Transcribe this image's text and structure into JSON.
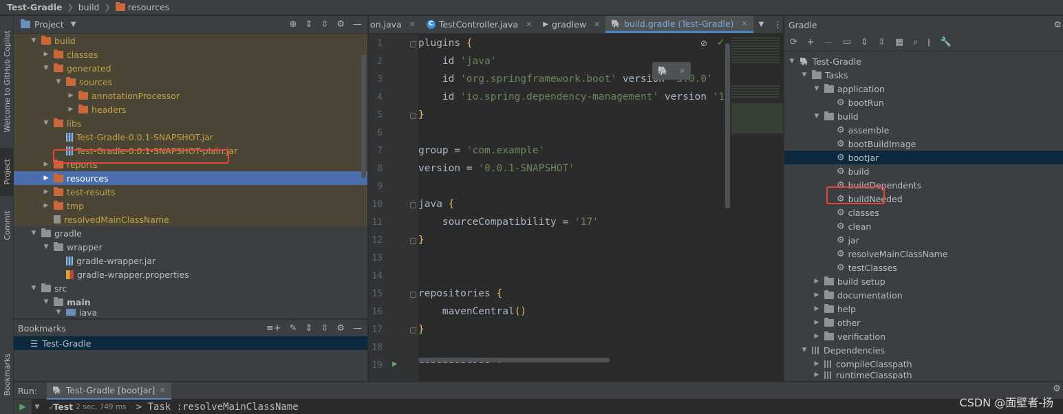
{
  "breadcrumb": {
    "project": "Test-Gradle",
    "item1": "build",
    "item2": "resources"
  },
  "left_strip": {
    "copilot": "Welcome to GitHub Copilot",
    "project": "Project",
    "commit": "Commit",
    "bookmarks": "Bookmarks"
  },
  "project_panel": {
    "title": "Project",
    "tree": {
      "build": "build",
      "classes": "classes",
      "generated": "generated",
      "sources": "sources",
      "annotationProcessor": "annotationProcessor",
      "headers": "headers",
      "libs": "libs",
      "jar1": "Test-Gradle-0.0.1-SNAPSHOT.jar",
      "jar2": "Test-Gradle-0.0.1-SNAPSHOT-plain.jar",
      "reports": "reports",
      "resources": "resources",
      "test_results": "test-results",
      "tmp": "tmp",
      "resolved": "resolvedMainClassName",
      "gradle": "gradle",
      "wrapper": "wrapper",
      "wrapper_jar": "gradle-wrapper.jar",
      "wrapper_props": "gradle-wrapper.properties",
      "src": "src",
      "main": "main",
      "java": "java"
    }
  },
  "bookmarks": {
    "title": "Bookmarks",
    "item": "Test-Gradle"
  },
  "editor": {
    "tabs": [
      "on.java",
      "TestController.java",
      "gradlew",
      "build.gradle (Test-Gradle)"
    ],
    "line_numbers": [
      "1",
      "2",
      "3",
      "4",
      "5",
      "6",
      "7",
      "8",
      "9",
      "10",
      "11",
      "12",
      "13",
      "14",
      "15",
      "16",
      "17",
      "18",
      "19"
    ],
    "code": {
      "l1a": "plugins ",
      "l1b": "{",
      "l2a": "    id ",
      "l2b": "'java'",
      "l3a": "    id ",
      "l3b": "'org.springframework.boot'",
      "l3c": " version ",
      "l3d": "'3.0.0'",
      "l4a": "    id ",
      "l4b": "'io.spring.dependency-management'",
      "l4c": " version ",
      "l4d": "'1",
      "l5": "}",
      "l7a": "group = ",
      "l7b": "'com.example'",
      "l8a": "version = ",
      "l8b": "'0.0.1-SNAPSHOT'",
      "l10a": "java ",
      "l10b": "{",
      "l11a": "    sourceCompatibility = ",
      "l11b": "'17'",
      "l12": "}",
      "l15a": "repositories ",
      "l15b": "{",
      "l16a": "    mavenCentral",
      "l16b": "()",
      "l17": "}",
      "l19a": "dependencies ",
      "l19b": "{"
    }
  },
  "gradle_panel": {
    "title": "Gradle",
    "tree": {
      "root": "Test-Gradle",
      "tasks": "Tasks",
      "application": "application",
      "bootRun": "bootRun",
      "build_group": "build",
      "assemble": "assemble",
      "bootBuildImage": "bootBuildImage",
      "bootJar": "bootJar",
      "build": "build",
      "buildDependents": "buildDependents",
      "buildNeeded": "buildNeeded",
      "classes": "classes",
      "clean": "clean",
      "jar": "jar",
      "resolveMainClassName": "resolveMainClassName",
      "testClasses": "testClasses",
      "build_setup": "build setup",
      "documentation": "documentation",
      "help": "help",
      "other": "other",
      "verification": "verification",
      "dependencies": "Dependencies",
      "compileClasspath": "compileClasspath",
      "runtimeClasspath": "runtimeClasspath"
    }
  },
  "run": {
    "label": "Run:",
    "tab": "Test-Gradle [bootJar]",
    "status": "Test",
    "duration": "2 sec, 749 ms",
    "output": "> Task :resolveMainClassName"
  },
  "watermark": "CSDN @面壁者-扬",
  "colors": {
    "selection": "#4b6eaf",
    "highlight_box": "#e8453c",
    "excluded_text": "#c2a149",
    "string": "#6a8759"
  }
}
